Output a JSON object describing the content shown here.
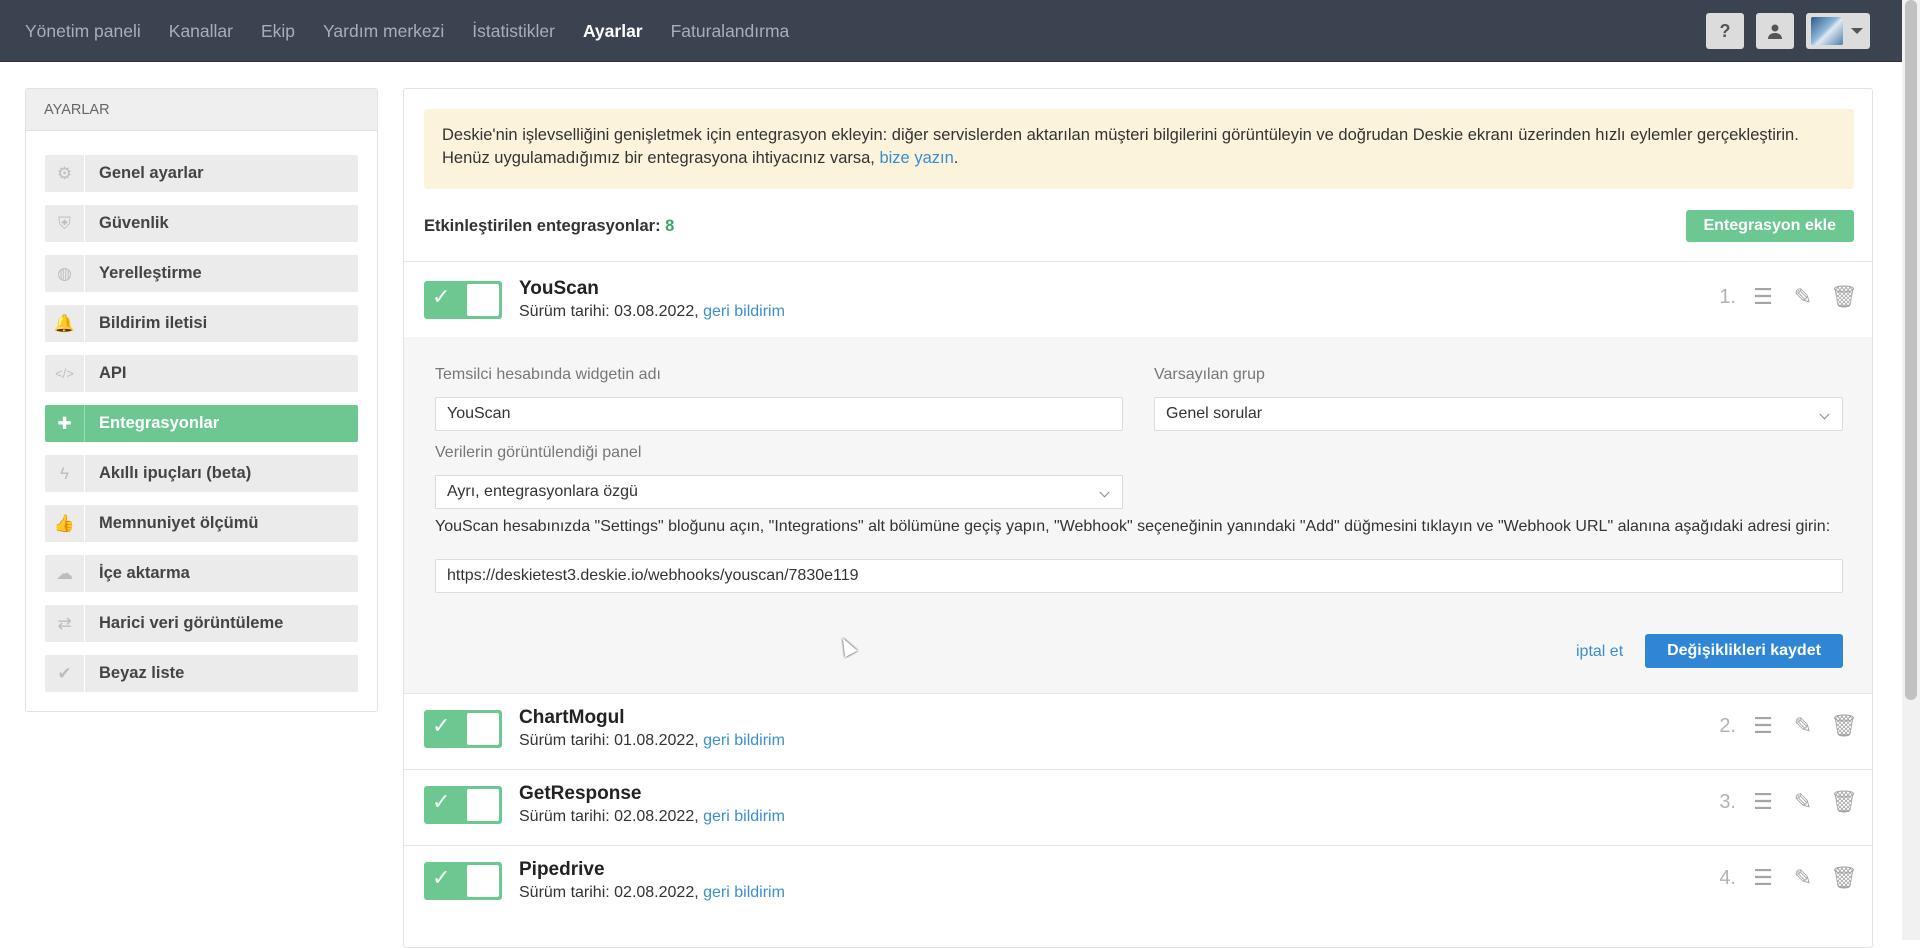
{
  "nav": {
    "items": [
      "Yönetim paneli",
      "Kanallar",
      "Ekip",
      "Yardım merkezi",
      "İstatistikler",
      "Ayarlar",
      "Faturalandırma"
    ],
    "active": "Ayarlar",
    "help_label": "?"
  },
  "sidebar": {
    "header": "AYARLAR",
    "items": [
      {
        "label": "Genel ayarlar",
        "icon": "gears-icon"
      },
      {
        "label": "Güvenlik",
        "icon": "shield-icon"
      },
      {
        "label": "Yerelleştirme",
        "icon": "globe-icon"
      },
      {
        "label": "Bildirim iletisi",
        "icon": "bell-icon"
      },
      {
        "label": "API",
        "icon": "code-icon"
      },
      {
        "label": "Entegrasyonlar",
        "icon": "puzzle-icon"
      },
      {
        "label": "Akıllı ipuçları (beta)",
        "icon": "lightning-icon"
      },
      {
        "label": "Memnuniyet ölçümü",
        "icon": "thumbs-up-icon"
      },
      {
        "label": "İçe aktarma",
        "icon": "cloud-upload-icon"
      },
      {
        "label": "Harici veri görüntüleme",
        "icon": "exchange-icon"
      },
      {
        "label": "Beyaz liste",
        "icon": "check-circle-icon"
      }
    ],
    "active_index": 5
  },
  "notice": {
    "text": "Deskie'nin işlevselliğini genişletmek için entegrasyon ekleyin: diğer servislerden aktarılan müşteri bilgilerini görüntüleyin ve doğrudan Deskie ekranı üzerinden hızlı eylemler gerçekleştirin. Henüz uygulamadığımız bir entegrasyona ihtiyacınız varsa, ",
    "link": "bize yazın",
    "end": "."
  },
  "enabled": {
    "label": "Etkinleştirilen entegrasyonlar:",
    "count": "8",
    "add_button": "Entegrasyon ekle"
  },
  "integrations": [
    {
      "name": "YouScan",
      "date_label": "Sürüm tarihi: 03.08.2022,",
      "feedback": "geri bildirim",
      "index": "1."
    },
    {
      "name": "ChartMogul",
      "date_label": "Sürüm tarihi: 01.08.2022,",
      "feedback": "geri bildirim",
      "index": "2."
    },
    {
      "name": "GetResponse",
      "date_label": "Sürüm tarihi: 02.08.2022,",
      "feedback": "geri bildirim",
      "index": "3."
    },
    {
      "name": "Pipedrive",
      "date_label": "Sürüm tarihi: 02.08.2022,",
      "feedback": "geri bildirim",
      "index": "4."
    }
  ],
  "edit_form": {
    "widget_name_label": "Temsilci hesabında widgetin adı",
    "widget_name_value": "YouScan",
    "default_group_label": "Varsayılan grup",
    "default_group_value": "Genel sorular",
    "panel_label": "Verilerin görüntülendiği panel",
    "panel_value": "Ayrı, entegrasyonlara özgü",
    "hint": "YouScan hesabınızda \"Settings\" bloğunu açın, \"Integrations\" alt bölümüne geçiş yapın, \"Webhook\" seçeneğinin yanındaki \"Add\" düğmesini tıklayın ve \"Webhook URL\" alanına aşağıdaki adresi girin:",
    "webhook_url": "https://deskietest3.deskie.io/webhooks/youscan/7830e119",
    "cancel": "iptal et",
    "save": "Değişiklikleri kaydet"
  },
  "colors": {
    "topbar": "#3b4350",
    "accent_green": "#6cc790",
    "primary_blue": "#2f86d4",
    "notice_bg": "#fcf3dc"
  }
}
